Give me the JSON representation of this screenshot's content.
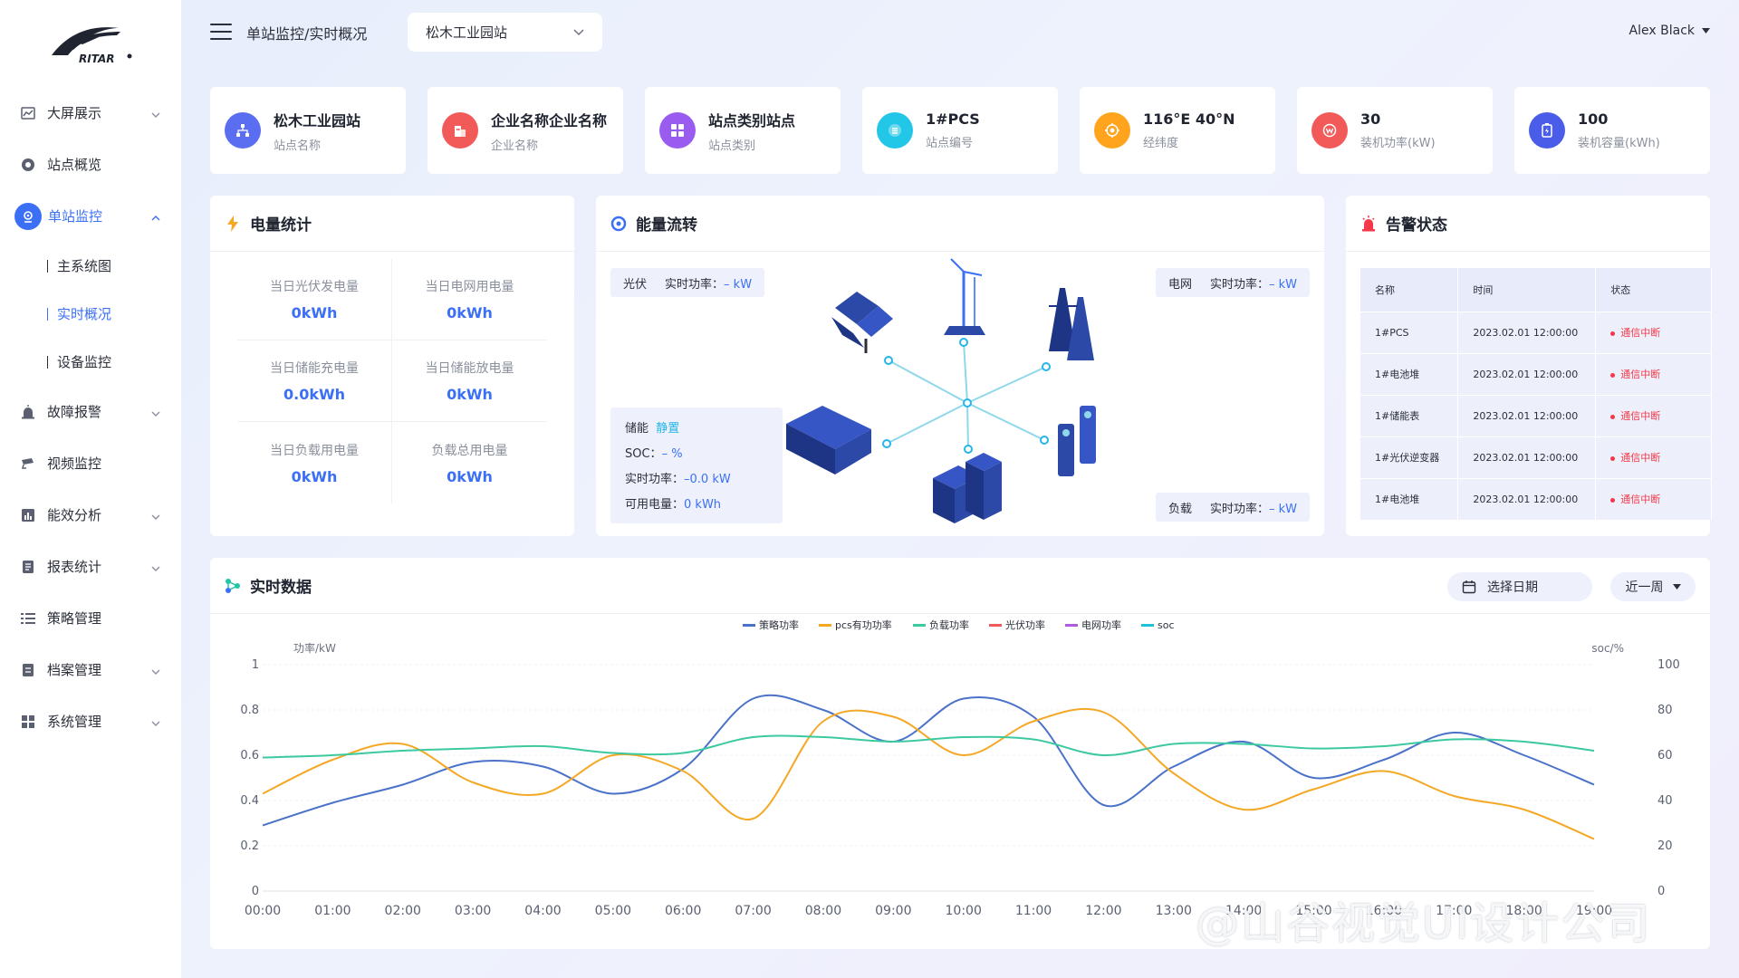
{
  "brand": {
    "logo_text": "RITAR"
  },
  "sidebar": {
    "items": [
      {
        "label": "大屏展示",
        "icon": "chart-icon",
        "has_children": true
      },
      {
        "label": "站点概览",
        "icon": "circle-icon",
        "has_children": false
      },
      {
        "label": "单站监控",
        "icon": "monitor-icon",
        "has_children": true,
        "expanded": true,
        "active": true
      },
      {
        "label": "故障报警",
        "icon": "alarm-icon",
        "has_children": true
      },
      {
        "label": "视频监控",
        "icon": "camera-icon",
        "has_children": false
      },
      {
        "label": "能效分析",
        "icon": "bar-chart-icon",
        "has_children": true
      },
      {
        "label": "报表统计",
        "icon": "report-icon",
        "has_children": true
      },
      {
        "label": "策略管理",
        "icon": "list-icon",
        "has_children": false
      },
      {
        "label": "档案管理",
        "icon": "archive-icon",
        "has_children": true
      },
      {
        "label": "系统管理",
        "icon": "grid-icon",
        "has_children": true
      }
    ],
    "sub_items": [
      {
        "label": "主系统图",
        "active": false
      },
      {
        "label": "实时概况",
        "active": true
      },
      {
        "label": "设备监控",
        "active": false
      }
    ]
  },
  "header": {
    "breadcrumb": "单站监控/实时概况",
    "site_select": "松木工业园站",
    "user": "Alex Black"
  },
  "info_cards": [
    {
      "value": "松木工业园站",
      "label": "站点名称",
      "icon": "site-icon",
      "color": "#5b6df0"
    },
    {
      "value": "企业名称企业名称",
      "label": "企业名称",
      "icon": "building-icon",
      "color": "#f25a5a"
    },
    {
      "value": "站点类别站点",
      "label": "站点类别",
      "icon": "category-icon",
      "color": "#9a5cf0"
    },
    {
      "value": "1#PCS",
      "label": "站点编号",
      "icon": "number-icon",
      "color": "#22c6e6"
    },
    {
      "value": "116°E 40°N",
      "label": "经纬度",
      "icon": "location-icon",
      "color": "#ffa41c"
    },
    {
      "value": "30",
      "label": "装机功率(kW)",
      "icon": "power-icon",
      "color": "#f25a5a"
    },
    {
      "value": "100",
      "label": "装机容量(kWh)",
      "icon": "battery-icon",
      "color": "#4a5de8"
    }
  ],
  "energy_stats": {
    "title": "电量统计",
    "items": [
      {
        "label": "当日光伏发电量",
        "value": "0kWh"
      },
      {
        "label": "当日电网用电量",
        "value": "0kWh"
      },
      {
        "label": "当日储能充电量",
        "value": "0.0kWh"
      },
      {
        "label": "当日储能放电量",
        "value": "0kWh"
      },
      {
        "label": "当日负载用电量",
        "value": "0kWh"
      },
      {
        "label": "负载总用电量",
        "value": "0kWh"
      }
    ]
  },
  "energy_flow": {
    "title": "能量流转",
    "pv": {
      "name": "光伏",
      "label": "实时功率：",
      "value": "– kW"
    },
    "grid": {
      "name": "电网",
      "label": "实时功率：",
      "value": "– kW"
    },
    "load": {
      "name": "负载",
      "label": "实时功率：",
      "value": "– kW"
    },
    "storage": {
      "name": "储能",
      "state": "静置",
      "soc_label": "SOC：",
      "soc_value": "– %",
      "power_label": "实时功率：",
      "power_value": "–0.0 kW",
      "avail_label": "可用电量：",
      "avail_value": "0 kWh"
    }
  },
  "alarm": {
    "title": "告警状态",
    "columns": [
      "名称",
      "时间",
      "状态"
    ],
    "rows": [
      {
        "name": "1#PCS",
        "time": "2023.02.01 12:00:00",
        "status": "通信中断"
      },
      {
        "name": "1#电池堆",
        "time": "2023.02.01 12:00:00",
        "status": "通信中断"
      },
      {
        "name": "1#储能表",
        "time": "2023.02.01 12:00:00",
        "status": "通信中断"
      },
      {
        "name": "1#光伏逆变器",
        "time": "2023.02.01 12:00:00",
        "status": "通信中断"
      },
      {
        "name": "1#电池堆",
        "time": "2023.02.01 12:00:00",
        "status": "通信中断"
      }
    ]
  },
  "realtime": {
    "title": "实时数据",
    "date_button": "选择日期",
    "range_button": "近一周"
  },
  "chart_data": {
    "type": "line",
    "ylabel_left": "功率/kW",
    "ylabel_right": "soc/%",
    "ylim_left": [
      0,
      1
    ],
    "ylim_right": [
      0,
      100
    ],
    "yticks_left": [
      "0",
      "0.2",
      "0.4",
      "0.6",
      "0.8",
      "1"
    ],
    "yticks_right": [
      "0",
      "20",
      "40",
      "60",
      "80",
      "100"
    ],
    "x": [
      "00:00",
      "01:00",
      "02:00",
      "03:00",
      "04:00",
      "05:00",
      "06:00",
      "07:00",
      "08:00",
      "09:00",
      "10:00",
      "11:00",
      "12:00",
      "13:00",
      "14:00",
      "15:00",
      "16:00",
      "17:00",
      "18:00",
      "19:00"
    ],
    "xticks_shown": [
      "00:00",
      "01:00",
      "02:00",
      "03:00",
      "04:00",
      "05:00",
      "06:00",
      "07:00",
      "08:00",
      "09:00",
      "10:00",
      "11:00",
      "12:00",
      "13:00",
      "14:00",
      "15:00",
      "16:00",
      "17:00",
      "18:00",
      "19:00"
    ],
    "legend_position": "top-center",
    "series": [
      {
        "name": "策略功率",
        "color": "#4a72c9",
        "axis": "left",
        "values": [
          0.29,
          0.39,
          0.47,
          0.57,
          0.55,
          0.43,
          0.54,
          0.85,
          0.8,
          0.66,
          0.85,
          0.77,
          0.38,
          0.55,
          0.66,
          0.5,
          0.58,
          0.7,
          0.6,
          0.47
        ]
      },
      {
        "name": "pcs有功功率",
        "color": "#f4a825",
        "axis": "left",
        "values": [
          0.43,
          0.58,
          0.65,
          0.48,
          0.43,
          0.6,
          0.53,
          0.32,
          0.75,
          0.77,
          0.6,
          0.75,
          0.79,
          0.52,
          0.36,
          0.45,
          0.53,
          0.42,
          0.36,
          0.23
        ]
      },
      {
        "name": "负载功率",
        "color": "#3cc9a0",
        "axis": "left",
        "values": [
          0.59,
          0.6,
          0.62,
          0.63,
          0.64,
          0.61,
          0.61,
          0.68,
          0.68,
          0.66,
          0.68,
          0.67,
          0.6,
          0.65,
          0.65,
          0.63,
          0.64,
          0.67,
          0.66,
          0.62
        ]
      },
      {
        "name": "光伏功率",
        "color": "#f25a5a",
        "axis": "left",
        "values": []
      },
      {
        "name": "电网功率",
        "color": "#b05ae0",
        "axis": "left",
        "values": []
      },
      {
        "name": "soc",
        "color": "#1fc0d8",
        "axis": "right",
        "values": []
      }
    ]
  },
  "watermark": "@山谷视觉UI设计公司"
}
